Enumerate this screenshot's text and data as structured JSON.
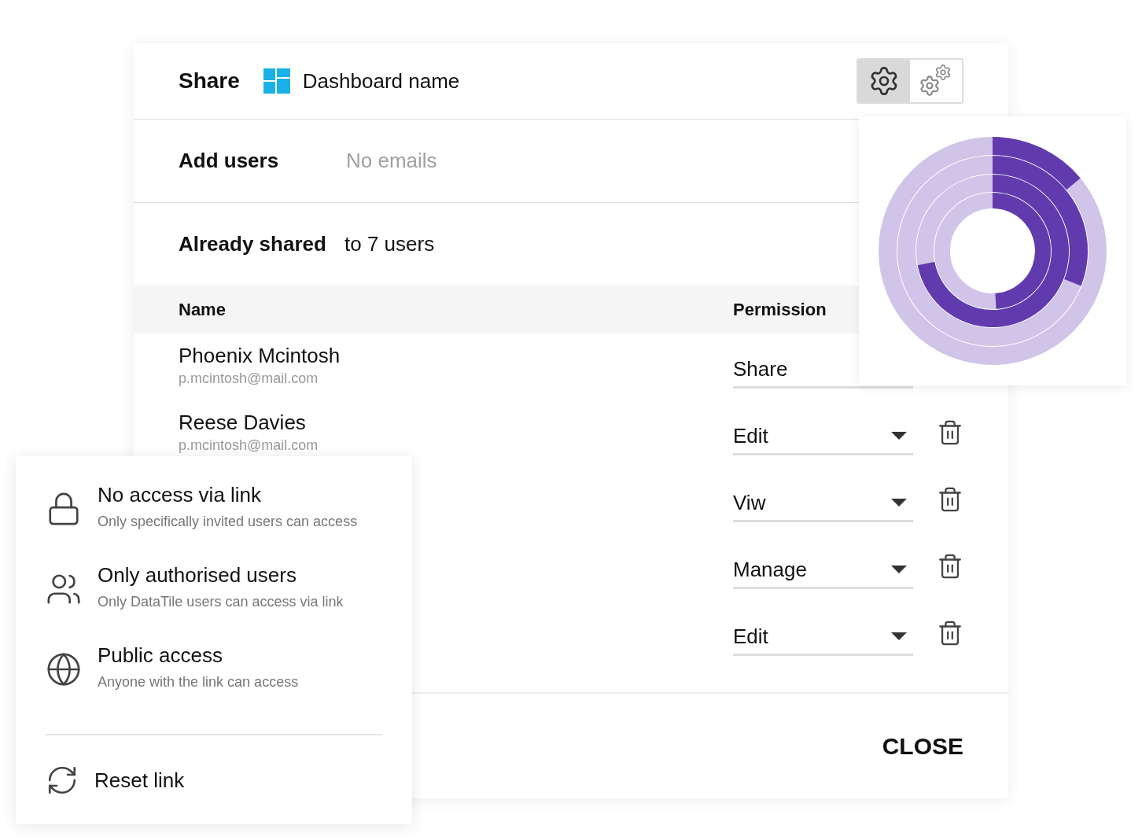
{
  "dialog": {
    "title": "Share",
    "dashboard_name": "Dashboard name",
    "view_toggle": [
      {
        "selected": true,
        "kind": "single"
      },
      {
        "selected": false,
        "kind": "multi"
      }
    ],
    "add_users": {
      "label": "Add users",
      "placeholder": "No emails"
    },
    "already_shared": {
      "label": "Already shared",
      "value": "to 7 users"
    },
    "table": {
      "columns": [
        "Name",
        "Permission"
      ],
      "rows": [
        {
          "name": "Phoenix Mcintosh",
          "email": "p.mcintosh@mail.com",
          "permission": "Share"
        },
        {
          "name": "Reese Davies",
          "email": "p.mcintosh@mail.com",
          "permission": "Edit"
        },
        {
          "permission": "Viw"
        },
        {
          "permission": "Manage"
        },
        {
          "permission": "Edit"
        }
      ]
    },
    "close": "CLOSE"
  },
  "link_menu": {
    "options": [
      {
        "kind": "lock",
        "title": "No access via link",
        "description": "Only specifically invited users can access"
      },
      {
        "kind": "users",
        "title": "Only authorised users",
        "description": "Only DataTile users can access via link"
      },
      {
        "kind": "globe",
        "title": "Public access",
        "description": "Anyone with the link can access"
      }
    ],
    "reset": "Reset link"
  }
}
